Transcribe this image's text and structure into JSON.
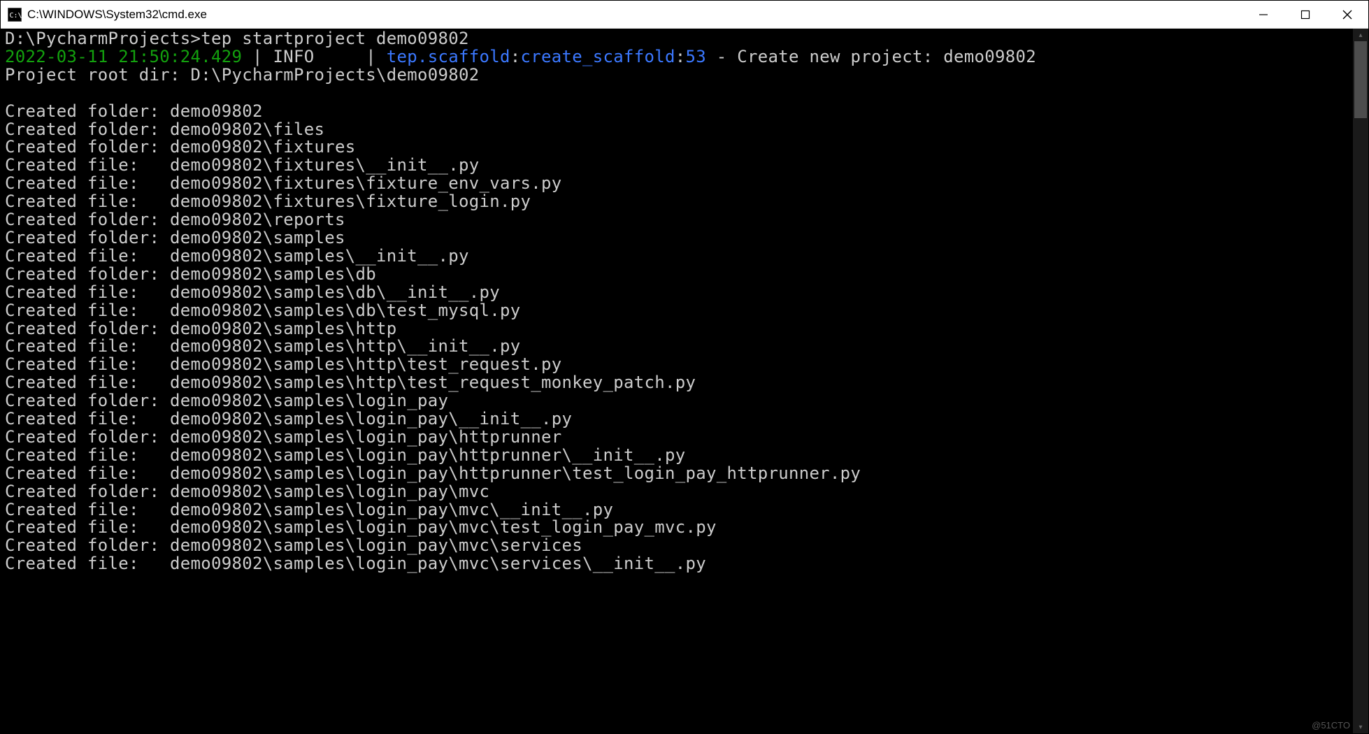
{
  "window": {
    "title": "C:\\WINDOWS\\System32\\cmd.exe"
  },
  "prompt": {
    "cwd": "D:\\PycharmProjects>",
    "command": "tep startproject demo09802"
  },
  "log": {
    "timestamp": "2022-03-11 21:50:24.429",
    "sep1": " | ",
    "level": "INFO    ",
    "sep2": " | ",
    "module": "tep.scaffold",
    "colon1": ":",
    "func": "create_scaffold",
    "colon2": ":",
    "lineno": "53",
    "dash": " - ",
    "message": "Create new project: demo09802"
  },
  "root_line": "Project root dir: D:\\PycharmProjects\\demo09802",
  "lines": [
    "",
    "Created folder: demo09802",
    "Created folder: demo09802\\files",
    "Created folder: demo09802\\fixtures",
    "Created file:   demo09802\\fixtures\\__init__.py",
    "Created file:   demo09802\\fixtures\\fixture_env_vars.py",
    "Created file:   demo09802\\fixtures\\fixture_login.py",
    "Created folder: demo09802\\reports",
    "Created folder: demo09802\\samples",
    "Created file:   demo09802\\samples\\__init__.py",
    "Created folder: demo09802\\samples\\db",
    "Created file:   demo09802\\samples\\db\\__init__.py",
    "Created file:   demo09802\\samples\\db\\test_mysql.py",
    "Created folder: demo09802\\samples\\http",
    "Created file:   demo09802\\samples\\http\\__init__.py",
    "Created file:   demo09802\\samples\\http\\test_request.py",
    "Created file:   demo09802\\samples\\http\\test_request_monkey_patch.py",
    "Created folder: demo09802\\samples\\login_pay",
    "Created file:   demo09802\\samples\\login_pay\\__init__.py",
    "Created folder: demo09802\\samples\\login_pay\\httprunner",
    "Created file:   demo09802\\samples\\login_pay\\httprunner\\__init__.py",
    "Created file:   demo09802\\samples\\login_pay\\httprunner\\test_login_pay_httprunner.py",
    "Created folder: demo09802\\samples\\login_pay\\mvc",
    "Created file:   demo09802\\samples\\login_pay\\mvc\\__init__.py",
    "Created file:   demo09802\\samples\\login_pay\\mvc\\test_login_pay_mvc.py",
    "Created folder: demo09802\\samples\\login_pay\\mvc\\services",
    "Created file:   demo09802\\samples\\login_pay\\mvc\\services\\__init__.py"
  ],
  "watermark": "@51CTO"
}
